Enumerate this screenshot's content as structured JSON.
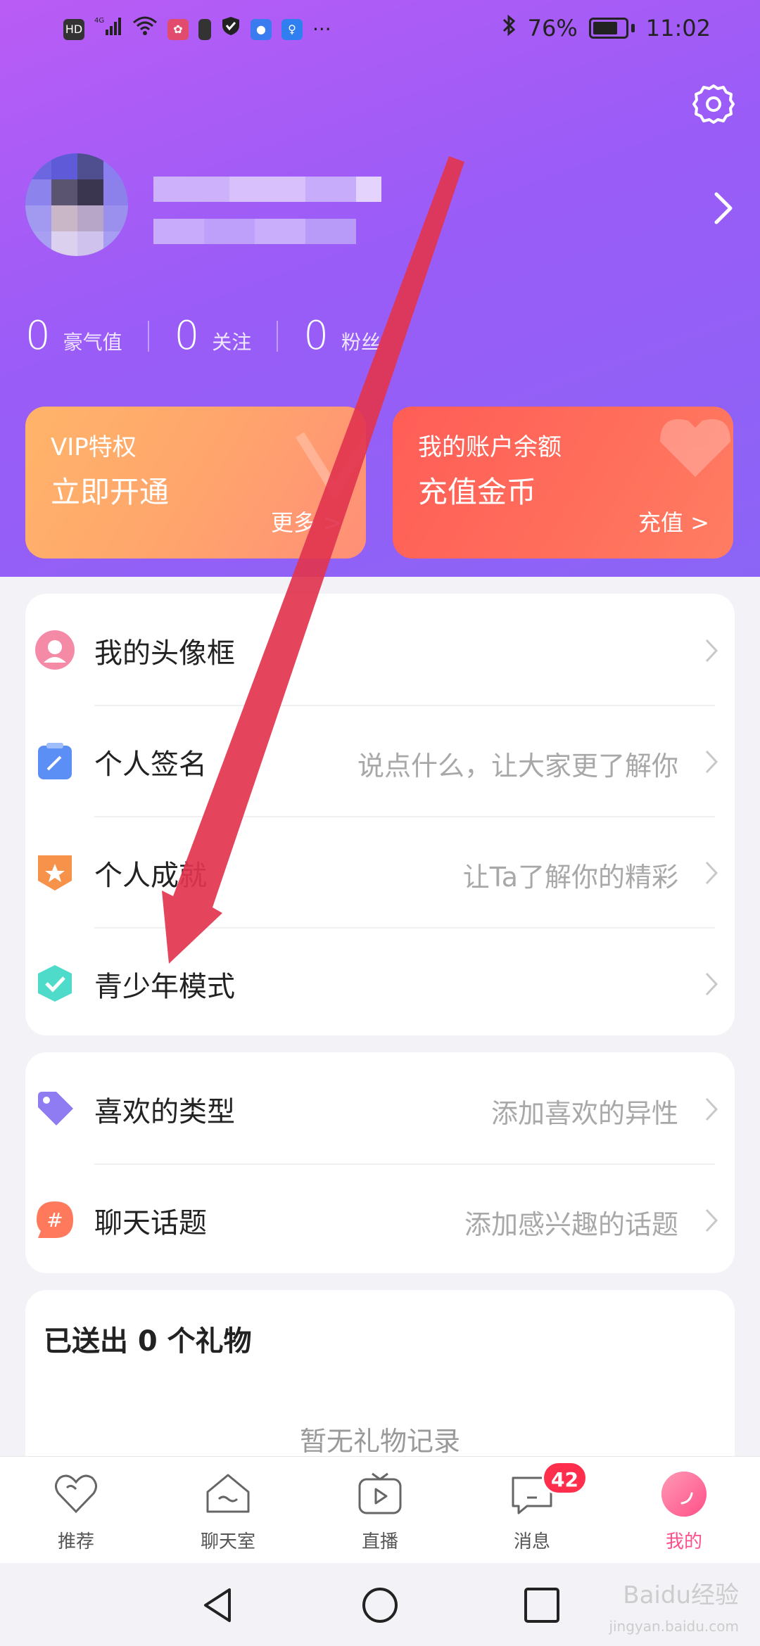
{
  "status_bar": {
    "left_icons": [
      "HD",
      "4G",
      "signal",
      "wifi",
      "app-a",
      "app-b",
      "shield",
      "app-c",
      "bulb",
      "more"
    ],
    "battery_percent": "76%",
    "time": "11:02"
  },
  "profile": {
    "stats": [
      {
        "value": "0",
        "label": "豪气值"
      },
      {
        "value": "0",
        "label": "关注"
      },
      {
        "value": "0",
        "label": "粉丝"
      }
    ]
  },
  "cards": {
    "vip": {
      "title": "VIP特权",
      "action": "立即开通",
      "link": "更多 >"
    },
    "balance": {
      "title": "我的账户余额",
      "action": "充值金币",
      "link": "充值 >"
    }
  },
  "menu_group1": [
    {
      "label": "我的头像框",
      "hint": ""
    },
    {
      "label": "个人签名",
      "hint": "说点什么，让大家更了解你"
    },
    {
      "label": "个人成就",
      "hint": "让Ta了解你的精彩"
    },
    {
      "label": "青少年模式",
      "hint": ""
    }
  ],
  "menu_group2": [
    {
      "label": "喜欢的类型",
      "hint": "添加喜欢的异性"
    },
    {
      "label": "聊天话题",
      "hint": "添加感兴趣的话题"
    }
  ],
  "gifts": {
    "title": "已送出 0 个礼物",
    "empty": "暂无礼物记录"
  },
  "bottom_nav": [
    {
      "label": "推荐",
      "icon": "heart-icon"
    },
    {
      "label": "聊天室",
      "icon": "chat-room-icon"
    },
    {
      "label": "直播",
      "icon": "live-tv-icon"
    },
    {
      "label": "消息",
      "icon": "message-icon",
      "badge": "42"
    },
    {
      "label": "我的",
      "icon": "profile-avatar-icon",
      "active": true
    }
  ],
  "watermark": {
    "text": "Baidu经验",
    "sub": "jingyan.baidu.com"
  },
  "colors": {
    "accent": "#ff4f88",
    "header_gradient": "#a25cf6",
    "badge": "#ff2e4d",
    "annotation_arrow": "#e2354f"
  }
}
